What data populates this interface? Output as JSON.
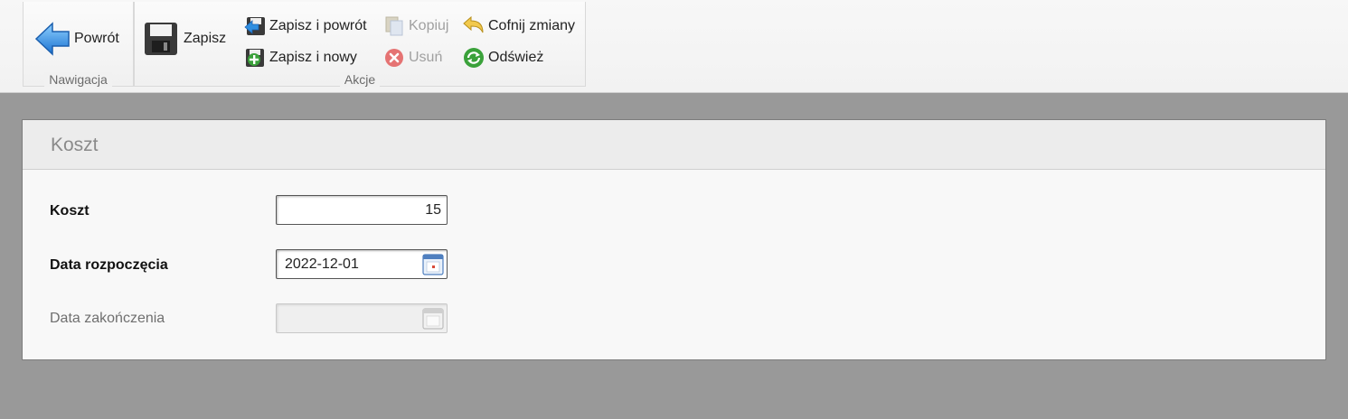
{
  "toolbar": {
    "groups": {
      "navigation": "Nawigacja",
      "actions": "Akcje"
    },
    "back_label": "Powrót",
    "save_label": "Zapisz",
    "save_return_label": "Zapisz i powrót",
    "save_new_label": "Zapisz i nowy",
    "copy_label": "Kopiuj",
    "delete_label": "Usuń",
    "undo_label": "Cofnij zmiany",
    "refresh_label": "Odśwież"
  },
  "panel": {
    "title": "Koszt"
  },
  "form": {
    "cost": {
      "label": "Koszt",
      "value": "15"
    },
    "start_date": {
      "label": "Data rozpoczęcia",
      "value": "2022-12-01"
    },
    "end_date": {
      "label": "Data zakończenia",
      "value": ""
    }
  },
  "colors": {
    "background": "#999999",
    "ribbon": "#f4f4f4",
    "panel_header": "#ececec",
    "back_arrow": "#2f8ee0",
    "delete_red": "#e57373",
    "refresh_green": "#3aa13a"
  },
  "icons": {
    "back": "arrow-left-icon",
    "save": "floppy-disk-icon",
    "save_return": "save-return-icon",
    "save_new": "save-new-icon",
    "copy": "copy-icon",
    "delete": "delete-icon",
    "undo": "undo-icon",
    "refresh": "refresh-icon",
    "calendar": "calendar-icon"
  }
}
